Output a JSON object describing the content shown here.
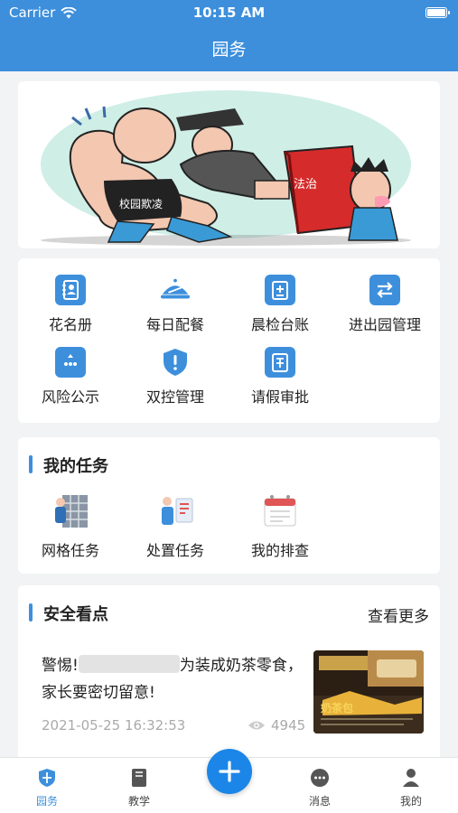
{
  "status_bar": {
    "carrier": "Carrier",
    "time": "10:15 AM"
  },
  "header": {
    "title": "园务"
  },
  "banner": {
    "sign_text": "校园欺凌",
    "book_text": "法治"
  },
  "menu": {
    "items": [
      {
        "label": "花名册",
        "icon": "roster-icon"
      },
      {
        "label": "每日配餐",
        "icon": "meal-icon"
      },
      {
        "label": "晨检台账",
        "icon": "ledger-icon"
      },
      {
        "label": "进出园管理",
        "icon": "transfer-icon"
      },
      {
        "label": "风险公示",
        "icon": "risk-icon"
      },
      {
        "label": "双控管理",
        "icon": "shield-icon"
      },
      {
        "label": "请假审批",
        "icon": "leave-icon"
      }
    ]
  },
  "tasks": {
    "title": "我的任务",
    "items": [
      {
        "label": "网格任务"
      },
      {
        "label": "处置任务"
      },
      {
        "label": "我的排查"
      }
    ]
  },
  "news": {
    "title": "安全看点",
    "more": "查看更多",
    "headline_pre": "警惕!",
    "headline_post": "为装成奶茶零食，家长要密切留意!",
    "date": "2021-05-25 16:32:53",
    "views": "4945",
    "thumb_text": "奶茶包"
  },
  "tabbar": {
    "items": [
      {
        "label": "园务",
        "active": true
      },
      {
        "label": "教学"
      },
      {
        "label": "消息"
      },
      {
        "label": "我的"
      }
    ],
    "accent": "#3d8fdc"
  }
}
